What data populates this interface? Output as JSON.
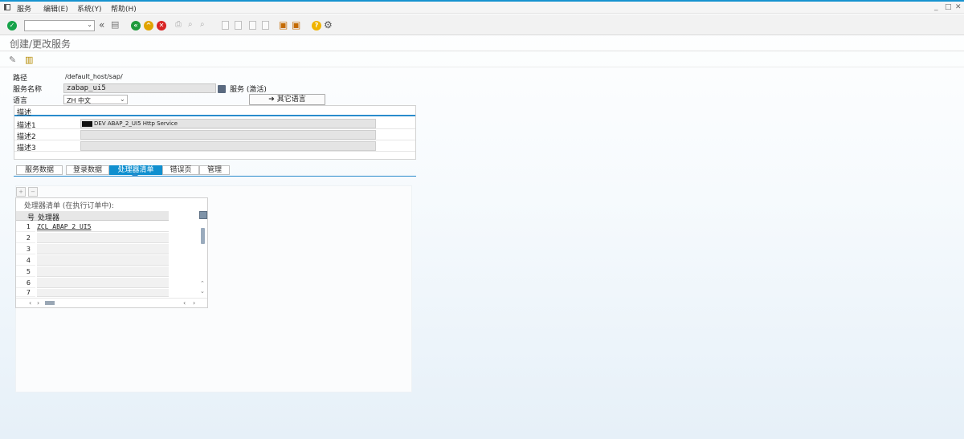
{
  "menu": {
    "items": [
      "服务",
      "编辑(E)",
      "系统(Y)",
      "帮助(H)"
    ],
    "window_controls": [
      "_",
      "□",
      "✕"
    ]
  },
  "toolbar": {
    "command_value": "",
    "colors": {
      "ok": "#16a34a",
      "back": "#1f9a3c",
      "exit": "#e1a400",
      "cancel": "#d92525",
      "help": "#f0b400"
    }
  },
  "page": {
    "title": "创建/更改服务"
  },
  "form": {
    "path_label": "路径",
    "path_value": "/default_host/sap/",
    "service_label": "服务名称",
    "service_value": "zabap_ui5",
    "service_status": "服务 (激活)",
    "language_label": "语言",
    "language_value": "ZH 中文",
    "other_lang_button": "其它语言"
  },
  "description": {
    "title": "描述",
    "rows": [
      {
        "label": "描述1",
        "value": "DEV ABAP_2_UI5 Http Service"
      },
      {
        "label": "描述2",
        "value": ""
      },
      {
        "label": "描述3",
        "value": ""
      }
    ]
  },
  "tabs": [
    {
      "label": "服务数据",
      "active": false
    },
    {
      "label": "登录数据",
      "active": false
    },
    {
      "label": "处理器清单",
      "active": true
    },
    {
      "label": "错误页",
      "active": false
    },
    {
      "label": "管理",
      "active": false
    }
  ],
  "handler_table": {
    "caption": "处理器清单 (在执行订单中):",
    "col_num": "号",
    "col_handler": "处理器",
    "rows": [
      {
        "n": "1",
        "handler": "ZCL_ABAP_2_UI5"
      },
      {
        "n": "2",
        "handler": ""
      },
      {
        "n": "3",
        "handler": ""
      },
      {
        "n": "4",
        "handler": ""
      },
      {
        "n": "5",
        "handler": ""
      },
      {
        "n": "6",
        "handler": ""
      },
      {
        "n": "7",
        "handler": ""
      }
    ]
  }
}
